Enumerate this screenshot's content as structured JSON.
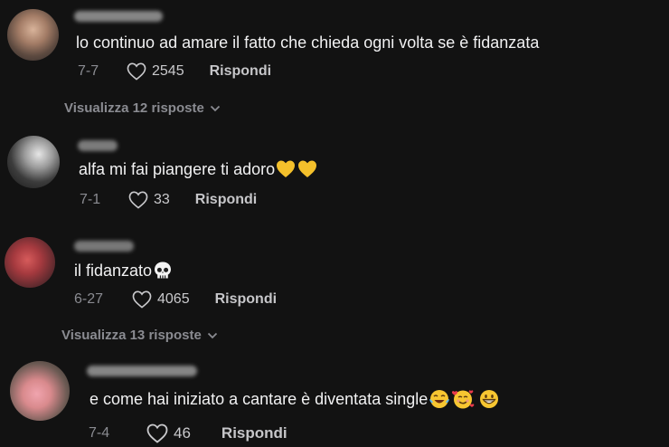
{
  "comments": [
    {
      "text": "lo continuo ad amare il fatto che chieda ogni volta se è fidanzata",
      "date": "7-7",
      "likes": "2545",
      "reply_label": "Rispondi",
      "view_replies": "Visualizza 12 risposte"
    },
    {
      "text": "alfa mi fai piangere ti adoro",
      "date": "7-1",
      "likes": "33",
      "reply_label": "Rispondi"
    },
    {
      "text": "il fidanzato",
      "date": "6-27",
      "likes": "4065",
      "reply_label": "Rispondi",
      "view_replies": "Visualizza 13 risposte"
    },
    {
      "text": "e come hai iniziato a cantare è diventata single",
      "date": "7-4",
      "likes": "46",
      "reply_label": "Rispondi"
    }
  ],
  "icons": {
    "like": "heart-outline-icon",
    "expand": "chevron-down-icon",
    "emojis": [
      "yellow-heart-icon",
      "skull-icon",
      "tears-of-joy-icon",
      "smiling-face-with-hearts-icon",
      "grinning-face-icon"
    ]
  },
  "colors": {
    "background": "#121212",
    "text": "#f1f1f2",
    "muted": "#8a8b91"
  }
}
